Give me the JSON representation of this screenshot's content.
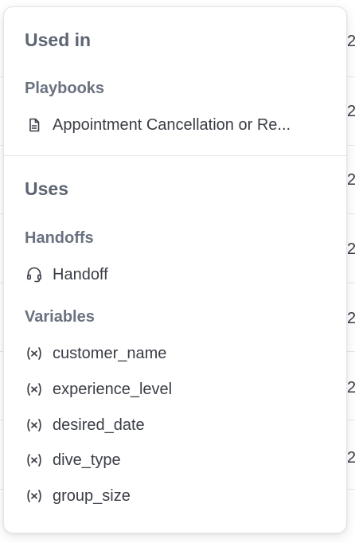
{
  "used_in": {
    "title": "Used in",
    "playbooks_heading": "Playbooks",
    "playbooks": [
      {
        "label": "Appointment Cancellation or Re...",
        "icon": "document-icon"
      }
    ]
  },
  "uses": {
    "title": "Uses",
    "handoffs_heading": "Handoffs",
    "handoffs": [
      {
        "label": "Handoff",
        "icon": "headset-icon"
      }
    ],
    "variables_heading": "Variables",
    "variables": [
      {
        "label": "customer_name",
        "icon": "variable-icon"
      },
      {
        "label": "experience_level",
        "icon": "variable-icon"
      },
      {
        "label": "desired_date",
        "icon": "variable-icon"
      },
      {
        "label": "dive_type",
        "icon": "variable-icon"
      },
      {
        "label": "group_size",
        "icon": "variable-icon"
      }
    ]
  },
  "background_rows": [
    "2",
    "2",
    "2",
    "2",
    "2",
    "2",
    "2"
  ],
  "colors": {
    "heading": "#5d6472",
    "text": "#3a3d45",
    "divider": "#e5e7eb"
  }
}
